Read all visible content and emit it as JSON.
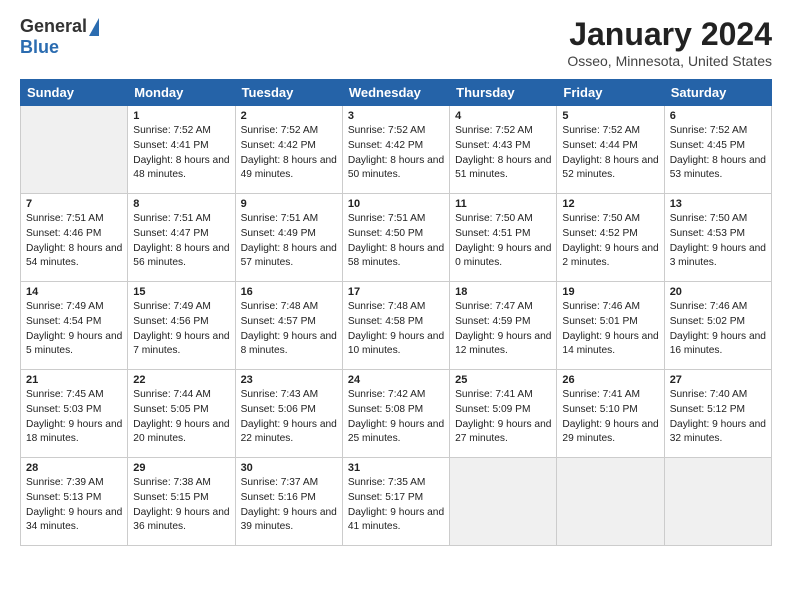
{
  "header": {
    "logo_general": "General",
    "logo_blue": "Blue",
    "title": "January 2024",
    "location": "Osseo, Minnesota, United States"
  },
  "days_of_week": [
    "Sunday",
    "Monday",
    "Tuesday",
    "Wednesday",
    "Thursday",
    "Friday",
    "Saturday"
  ],
  "weeks": [
    [
      {
        "day": "",
        "content": "",
        "gray": true
      },
      {
        "day": "1",
        "content": "Sunrise: 7:52 AM\nSunset: 4:41 PM\nDaylight: 8 hours\nand 48 minutes.",
        "gray": false
      },
      {
        "day": "2",
        "content": "Sunrise: 7:52 AM\nSunset: 4:42 PM\nDaylight: 8 hours\nand 49 minutes.",
        "gray": false
      },
      {
        "day": "3",
        "content": "Sunrise: 7:52 AM\nSunset: 4:42 PM\nDaylight: 8 hours\nand 50 minutes.",
        "gray": false
      },
      {
        "day": "4",
        "content": "Sunrise: 7:52 AM\nSunset: 4:43 PM\nDaylight: 8 hours\nand 51 minutes.",
        "gray": false
      },
      {
        "day": "5",
        "content": "Sunrise: 7:52 AM\nSunset: 4:44 PM\nDaylight: 8 hours\nand 52 minutes.",
        "gray": false
      },
      {
        "day": "6",
        "content": "Sunrise: 7:52 AM\nSunset: 4:45 PM\nDaylight: 8 hours\nand 53 minutes.",
        "gray": false
      }
    ],
    [
      {
        "day": "7",
        "content": "Sunrise: 7:51 AM\nSunset: 4:46 PM\nDaylight: 8 hours\nand 54 minutes.",
        "gray": false
      },
      {
        "day": "8",
        "content": "Sunrise: 7:51 AM\nSunset: 4:47 PM\nDaylight: 8 hours\nand 56 minutes.",
        "gray": false
      },
      {
        "day": "9",
        "content": "Sunrise: 7:51 AM\nSunset: 4:49 PM\nDaylight: 8 hours\nand 57 minutes.",
        "gray": false
      },
      {
        "day": "10",
        "content": "Sunrise: 7:51 AM\nSunset: 4:50 PM\nDaylight: 8 hours\nand 58 minutes.",
        "gray": false
      },
      {
        "day": "11",
        "content": "Sunrise: 7:50 AM\nSunset: 4:51 PM\nDaylight: 9 hours\nand 0 minutes.",
        "gray": false
      },
      {
        "day": "12",
        "content": "Sunrise: 7:50 AM\nSunset: 4:52 PM\nDaylight: 9 hours\nand 2 minutes.",
        "gray": false
      },
      {
        "day": "13",
        "content": "Sunrise: 7:50 AM\nSunset: 4:53 PM\nDaylight: 9 hours\nand 3 minutes.",
        "gray": false
      }
    ],
    [
      {
        "day": "14",
        "content": "Sunrise: 7:49 AM\nSunset: 4:54 PM\nDaylight: 9 hours\nand 5 minutes.",
        "gray": false
      },
      {
        "day": "15",
        "content": "Sunrise: 7:49 AM\nSunset: 4:56 PM\nDaylight: 9 hours\nand 7 minutes.",
        "gray": false
      },
      {
        "day": "16",
        "content": "Sunrise: 7:48 AM\nSunset: 4:57 PM\nDaylight: 9 hours\nand 8 minutes.",
        "gray": false
      },
      {
        "day": "17",
        "content": "Sunrise: 7:48 AM\nSunset: 4:58 PM\nDaylight: 9 hours\nand 10 minutes.",
        "gray": false
      },
      {
        "day": "18",
        "content": "Sunrise: 7:47 AM\nSunset: 4:59 PM\nDaylight: 9 hours\nand 12 minutes.",
        "gray": false
      },
      {
        "day": "19",
        "content": "Sunrise: 7:46 AM\nSunset: 5:01 PM\nDaylight: 9 hours\nand 14 minutes.",
        "gray": false
      },
      {
        "day": "20",
        "content": "Sunrise: 7:46 AM\nSunset: 5:02 PM\nDaylight: 9 hours\nand 16 minutes.",
        "gray": false
      }
    ],
    [
      {
        "day": "21",
        "content": "Sunrise: 7:45 AM\nSunset: 5:03 PM\nDaylight: 9 hours\nand 18 minutes.",
        "gray": false
      },
      {
        "day": "22",
        "content": "Sunrise: 7:44 AM\nSunset: 5:05 PM\nDaylight: 9 hours\nand 20 minutes.",
        "gray": false
      },
      {
        "day": "23",
        "content": "Sunrise: 7:43 AM\nSunset: 5:06 PM\nDaylight: 9 hours\nand 22 minutes.",
        "gray": false
      },
      {
        "day": "24",
        "content": "Sunrise: 7:42 AM\nSunset: 5:08 PM\nDaylight: 9 hours\nand 25 minutes.",
        "gray": false
      },
      {
        "day": "25",
        "content": "Sunrise: 7:41 AM\nSunset: 5:09 PM\nDaylight: 9 hours\nand 27 minutes.",
        "gray": false
      },
      {
        "day": "26",
        "content": "Sunrise: 7:41 AM\nSunset: 5:10 PM\nDaylight: 9 hours\nand 29 minutes.",
        "gray": false
      },
      {
        "day": "27",
        "content": "Sunrise: 7:40 AM\nSunset: 5:12 PM\nDaylight: 9 hours\nand 32 minutes.",
        "gray": false
      }
    ],
    [
      {
        "day": "28",
        "content": "Sunrise: 7:39 AM\nSunset: 5:13 PM\nDaylight: 9 hours\nand 34 minutes.",
        "gray": false
      },
      {
        "day": "29",
        "content": "Sunrise: 7:38 AM\nSunset: 5:15 PM\nDaylight: 9 hours\nand 36 minutes.",
        "gray": false
      },
      {
        "day": "30",
        "content": "Sunrise: 7:37 AM\nSunset: 5:16 PM\nDaylight: 9 hours\nand 39 minutes.",
        "gray": false
      },
      {
        "day": "31",
        "content": "Sunrise: 7:35 AM\nSunset: 5:17 PM\nDaylight: 9 hours\nand 41 minutes.",
        "gray": false
      },
      {
        "day": "",
        "content": "",
        "gray": true
      },
      {
        "day": "",
        "content": "",
        "gray": true
      },
      {
        "day": "",
        "content": "",
        "gray": true
      }
    ]
  ]
}
